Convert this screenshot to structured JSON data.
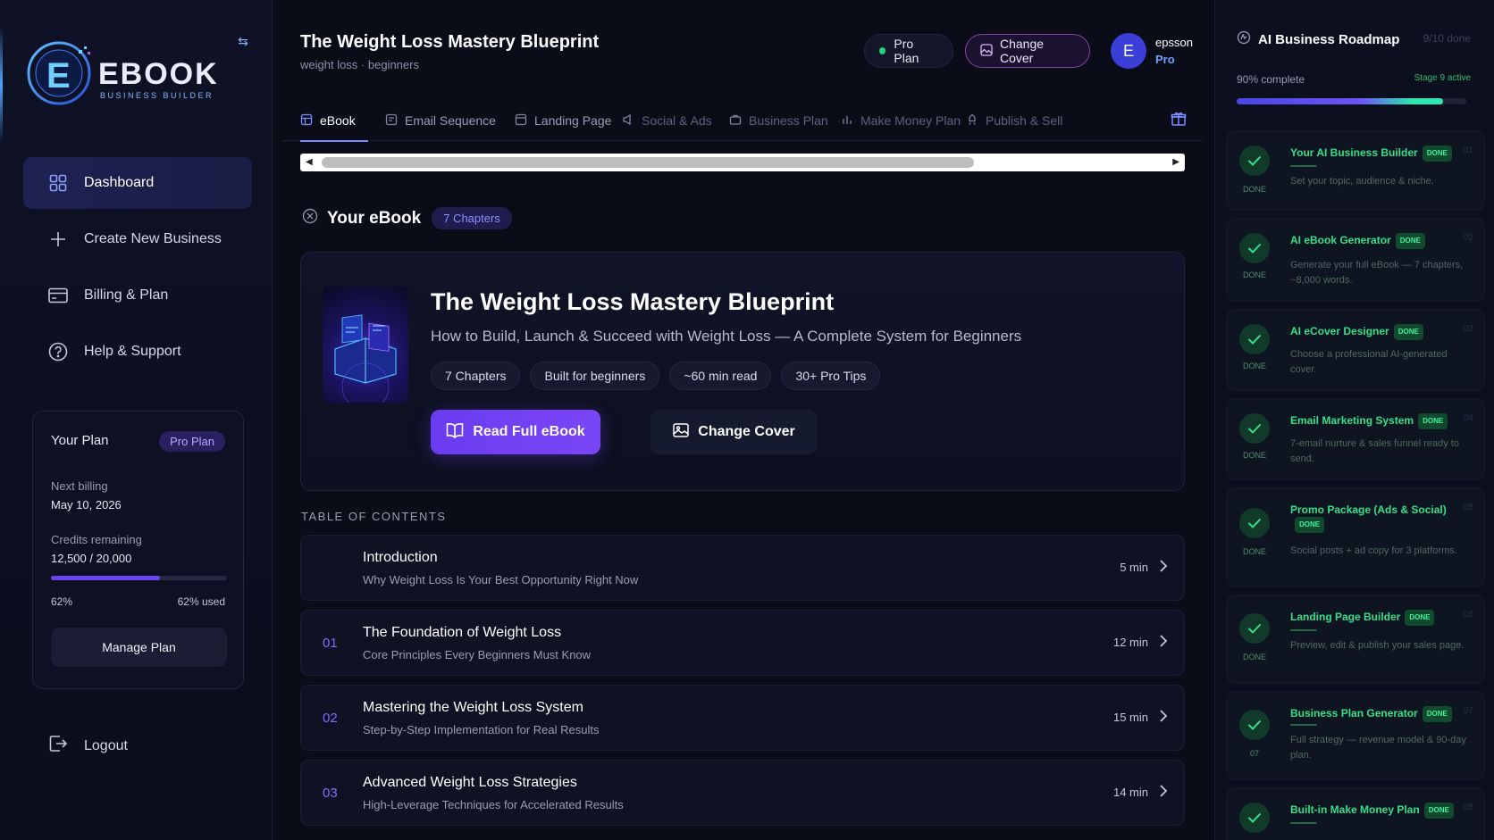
{
  "sidebar": {
    "logo": {
      "word": "EBOOK",
      "tagline": "BUSINESS BUILDER"
    },
    "nav": [
      {
        "label": "Dashboard",
        "icon": "grid-icon",
        "active": true
      },
      {
        "label": "Create New Business",
        "icon": "plus-icon",
        "active": false
      },
      {
        "label": "Billing & Plan",
        "icon": "card-icon",
        "active": false
      },
      {
        "label": "Help & Support",
        "icon": "help-icon",
        "active": false
      }
    ],
    "plan": {
      "title": "Your Plan",
      "badge": "Pro Plan",
      "next_billing_label": "Next billing",
      "next_billing_value": "May 10, 2026",
      "credits_label": "Credits remaining",
      "credits_value": "12,500 / 20,000",
      "progress": 0.62,
      "pct_left": "62%",
      "pct_right": "62% used",
      "manage_label": "Manage Plan"
    },
    "logout_label": "Logout"
  },
  "header": {
    "title": "The Weight Loss Mastery Blueprint",
    "subtitle": "weight loss · beginners",
    "plan_pill": "Pro Plan",
    "cover_pill": "Change Cover",
    "avatar_initial": "E",
    "user_name": "epsson",
    "user_tier": "Pro"
  },
  "tabs": [
    {
      "label": "eBook",
      "active": true
    },
    {
      "label": "Email Sequence",
      "active": false
    },
    {
      "label": "Landing Page",
      "active": false
    },
    {
      "label": "Social & Ads",
      "active": false
    },
    {
      "label": "Business Plan",
      "active": false
    },
    {
      "label": "Make Money Plan",
      "active": false
    },
    {
      "label": "Publish & Sell",
      "active": false
    }
  ],
  "ebook": {
    "section_title": "Your eBook",
    "chapters_badge": "7 Chapters",
    "title": "The Weight Loss Mastery Blueprint",
    "subtitle": "How to Build, Launch & Succeed with Weight Loss — A Complete System for Beginners",
    "chips": [
      "7 Chapters",
      "Built for beginners",
      "~60 min read",
      "30+ Pro Tips"
    ],
    "read_label": "Read Full eBook",
    "cover_label": "Change Cover"
  },
  "toc": {
    "label": "TABLE OF CONTENTS",
    "items": [
      {
        "num": "",
        "title": "Introduction",
        "desc": "Why Weight Loss Is Your Best Opportunity Right Now",
        "time": "5 min"
      },
      {
        "num": "01",
        "title": "The Foundation of Weight Loss",
        "desc": "Core Principles Every Beginners Must Know",
        "time": "12 min"
      },
      {
        "num": "02",
        "title": "Mastering the Weight Loss System",
        "desc": "Step-by-Step Implementation for Real Results",
        "time": "15 min"
      },
      {
        "num": "03",
        "title": "Advanced Weight Loss Strategies",
        "desc": "High-Leverage Techniques for Accelerated Results",
        "time": "14 min"
      }
    ]
  },
  "roadmap": {
    "title": "AI Business Roadmap",
    "done_count": "9/10 done",
    "pct_label": "90% complete",
    "status_label": "Stage 9 active",
    "progress": 0.9,
    "steps": [
      {
        "name": "Your AI Business Builder",
        "badge": "DONE",
        "num": "01",
        "state": "DONE",
        "desc": "Set your topic, audience & niche."
      },
      {
        "name": "AI eBook Generator",
        "badge": "DONE",
        "num": "02",
        "state": "DONE",
        "desc": "Generate your full eBook — 7 chapters, ~8,000 words."
      },
      {
        "name": "AI eCover Designer",
        "badge": "DONE",
        "num": "03",
        "state": "DONE",
        "desc": "Choose a professional AI-generated cover."
      },
      {
        "name": "Email Marketing System",
        "badge": "DONE",
        "num": "04",
        "state": "DONE",
        "desc": "7-email nurture & sales funnel ready to send."
      },
      {
        "name": "Promo Package (Ads & Social)",
        "badge": "DONE",
        "num": "05",
        "state": "DONE",
        "desc": "Social posts + ad copy for 3 platforms."
      },
      {
        "name": "Landing Page Builder",
        "badge": "DONE",
        "num": "06",
        "state": "DONE",
        "desc": "Preview, edit & publish your sales page."
      },
      {
        "name": "Business Plan Generator",
        "badge": "DONE",
        "num": "07",
        "state": "07",
        "desc": "Full strategy — revenue model & 90-day plan."
      },
      {
        "name": "Built-in Make Money Plan",
        "badge": "DONE",
        "num": "08",
        "state": "",
        "desc": ""
      }
    ]
  }
}
